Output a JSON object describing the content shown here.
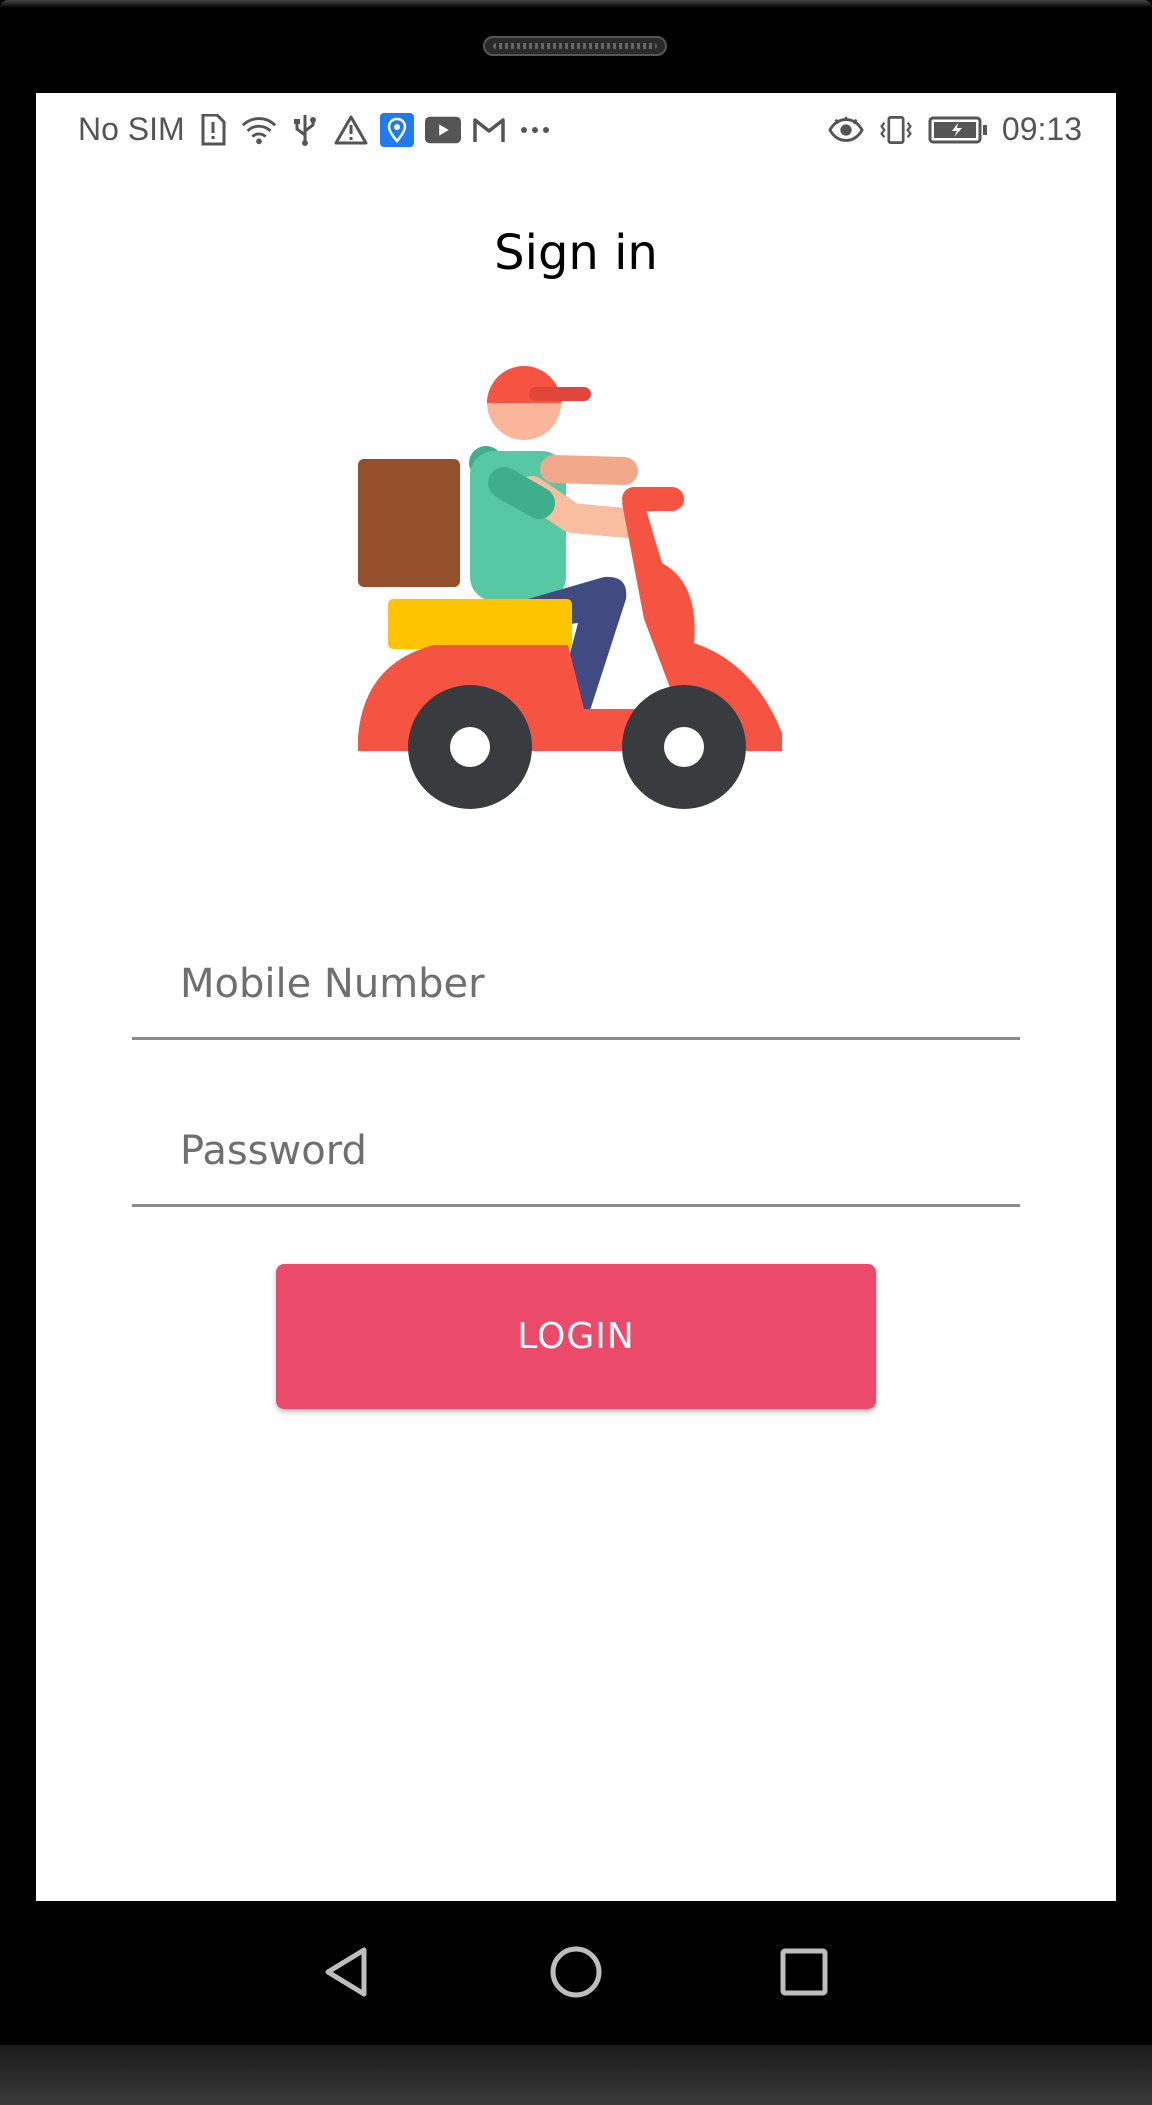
{
  "status_bar": {
    "carrier": "No SIM",
    "time": "09:13",
    "left_icons": [
      "sim-alert-icon",
      "wifi-icon",
      "usb-icon",
      "warning-icon",
      "location-app-icon",
      "youtube-icon",
      "gmail-icon",
      "more-dots-icon"
    ],
    "right_icons": [
      "eye-icon",
      "vibrate-icon",
      "battery-charging-icon"
    ]
  },
  "page": {
    "title": "Sign in"
  },
  "form": {
    "mobile_placeholder": "Mobile Number",
    "password_placeholder": "Password",
    "login_label": "LOGIN"
  },
  "colors": {
    "accent": "#ec4a6a",
    "scooter": "#f55442",
    "box": "#93502b",
    "seat": "#ffc400",
    "shirt": "#56c9a4",
    "pants": "#424a82",
    "wheel": "#393c3f"
  },
  "nav": {
    "icons": [
      "back-icon",
      "home-icon",
      "recents-icon"
    ]
  }
}
